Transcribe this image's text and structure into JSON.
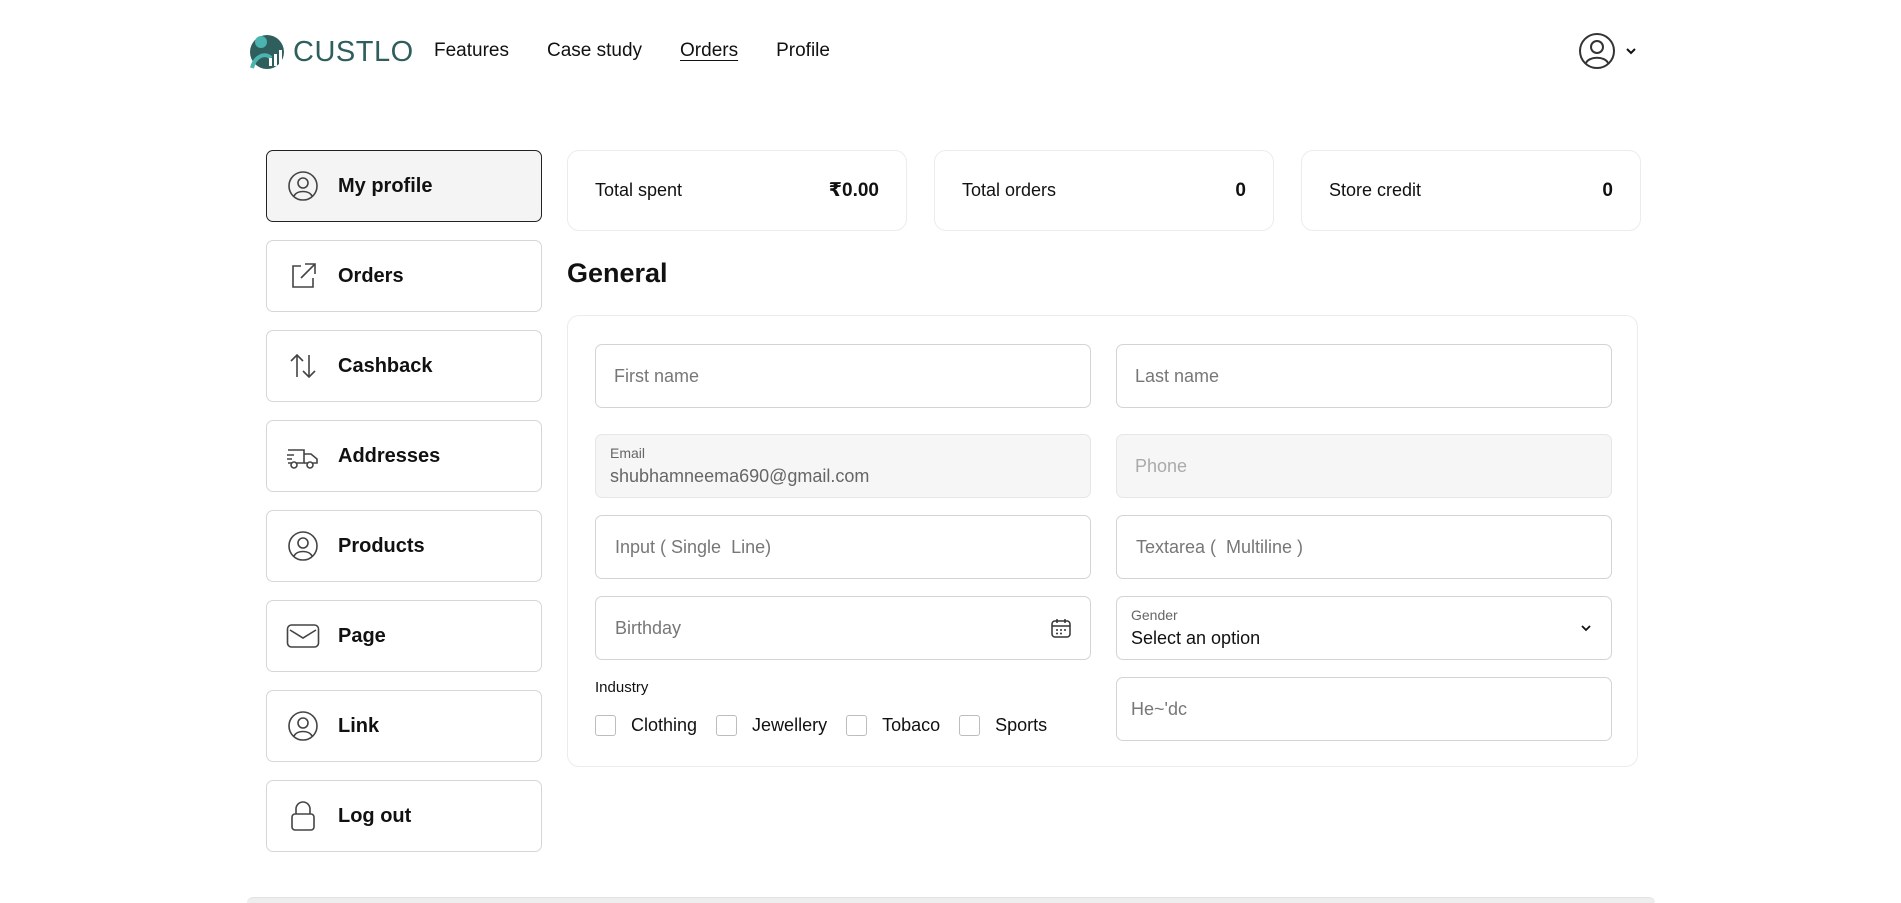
{
  "header": {
    "brand": "CUSTLO",
    "nav": [
      {
        "label": "Features"
      },
      {
        "label": "Case study"
      },
      {
        "label": "Orders"
      },
      {
        "label": "Profile"
      }
    ]
  },
  "sidebar": {
    "items": [
      {
        "label": "My profile",
        "icon": "user-circle-icon"
      },
      {
        "label": "Orders",
        "icon": "external-link-icon"
      },
      {
        "label": "Cashback",
        "icon": "arrows-up-down-icon"
      },
      {
        "label": "Addresses",
        "icon": "delivery-truck-icon"
      },
      {
        "label": "Products",
        "icon": "user-circle-icon"
      },
      {
        "label": "Page",
        "icon": "mail-icon"
      },
      {
        "label": "Link",
        "icon": "user-circle-icon"
      },
      {
        "label": "Log out",
        "icon": "lock-icon"
      }
    ]
  },
  "stats": {
    "total_spent": {
      "label": "Total spent",
      "value": "₹0.00"
    },
    "total_orders": {
      "label": "Total orders",
      "value": "0"
    },
    "store_credit": {
      "label": "Store credit",
      "value": "0"
    }
  },
  "general": {
    "title": "General",
    "first_name": {
      "placeholder": "First name",
      "value": ""
    },
    "last_name": {
      "placeholder": "Last name",
      "value": ""
    },
    "email": {
      "label": "Email",
      "value": "shubhamneema690@gmail.com"
    },
    "phone": {
      "placeholder": "Phone",
      "value": ""
    },
    "input_single": {
      "placeholder": "Input ( Single  Line)",
      "value": ""
    },
    "textarea_multi": {
      "placeholder": "Textarea (  Multiline )",
      "value": ""
    },
    "birthday": {
      "placeholder": "Birthday",
      "value": ""
    },
    "gender": {
      "label": "Gender",
      "value": "Select an option"
    },
    "industry": {
      "label": "Industry",
      "options": [
        {
          "label": "Clothing",
          "checked": false
        },
        {
          "label": "Jewellery",
          "checked": false
        },
        {
          "label": "Tobaco",
          "checked": false
        },
        {
          "label": "Sports",
          "checked": false
        }
      ]
    },
    "extra": {
      "placeholder": "He~'dc",
      "value": ""
    }
  },
  "colors": {
    "brand": "#2f5f5d",
    "logo_accent": "#4bb3b0"
  }
}
